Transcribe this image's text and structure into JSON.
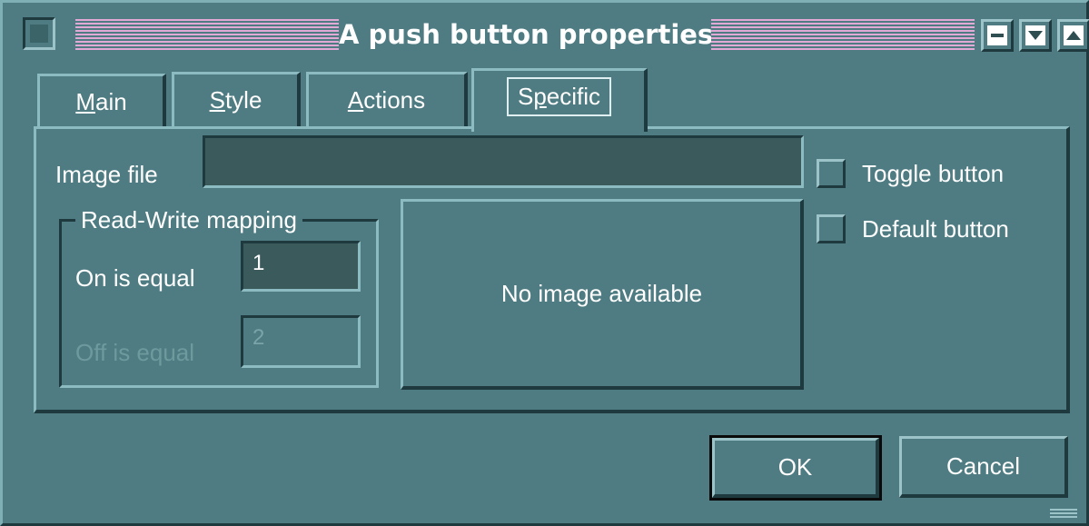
{
  "window": {
    "title": "A push button properties"
  },
  "tabs": [
    {
      "label_first": "M",
      "label_rest": "ain"
    },
    {
      "label_first": "S",
      "label_rest": "tyle"
    },
    {
      "label_first": "A",
      "label_rest": "ctions"
    },
    {
      "label_pre": "S",
      "label_u": "p",
      "label_rest": "ecific",
      "active": true
    }
  ],
  "specific": {
    "image_file_label": "Image file",
    "image_file_value": "",
    "group_title": "Read-Write mapping",
    "on_label": "On is equal",
    "on_value": "1",
    "off_label": "Off is equal",
    "off_value": "2",
    "image_placeholder": "No image available",
    "toggle_label": "Toggle button",
    "default_label": "Default button"
  },
  "buttons": {
    "ok": "OK",
    "cancel": "Cancel"
  },
  "colors": {
    "background": "#4e7c82",
    "title_stripes": "#e2a8d6",
    "field": "#3a5a5c"
  }
}
